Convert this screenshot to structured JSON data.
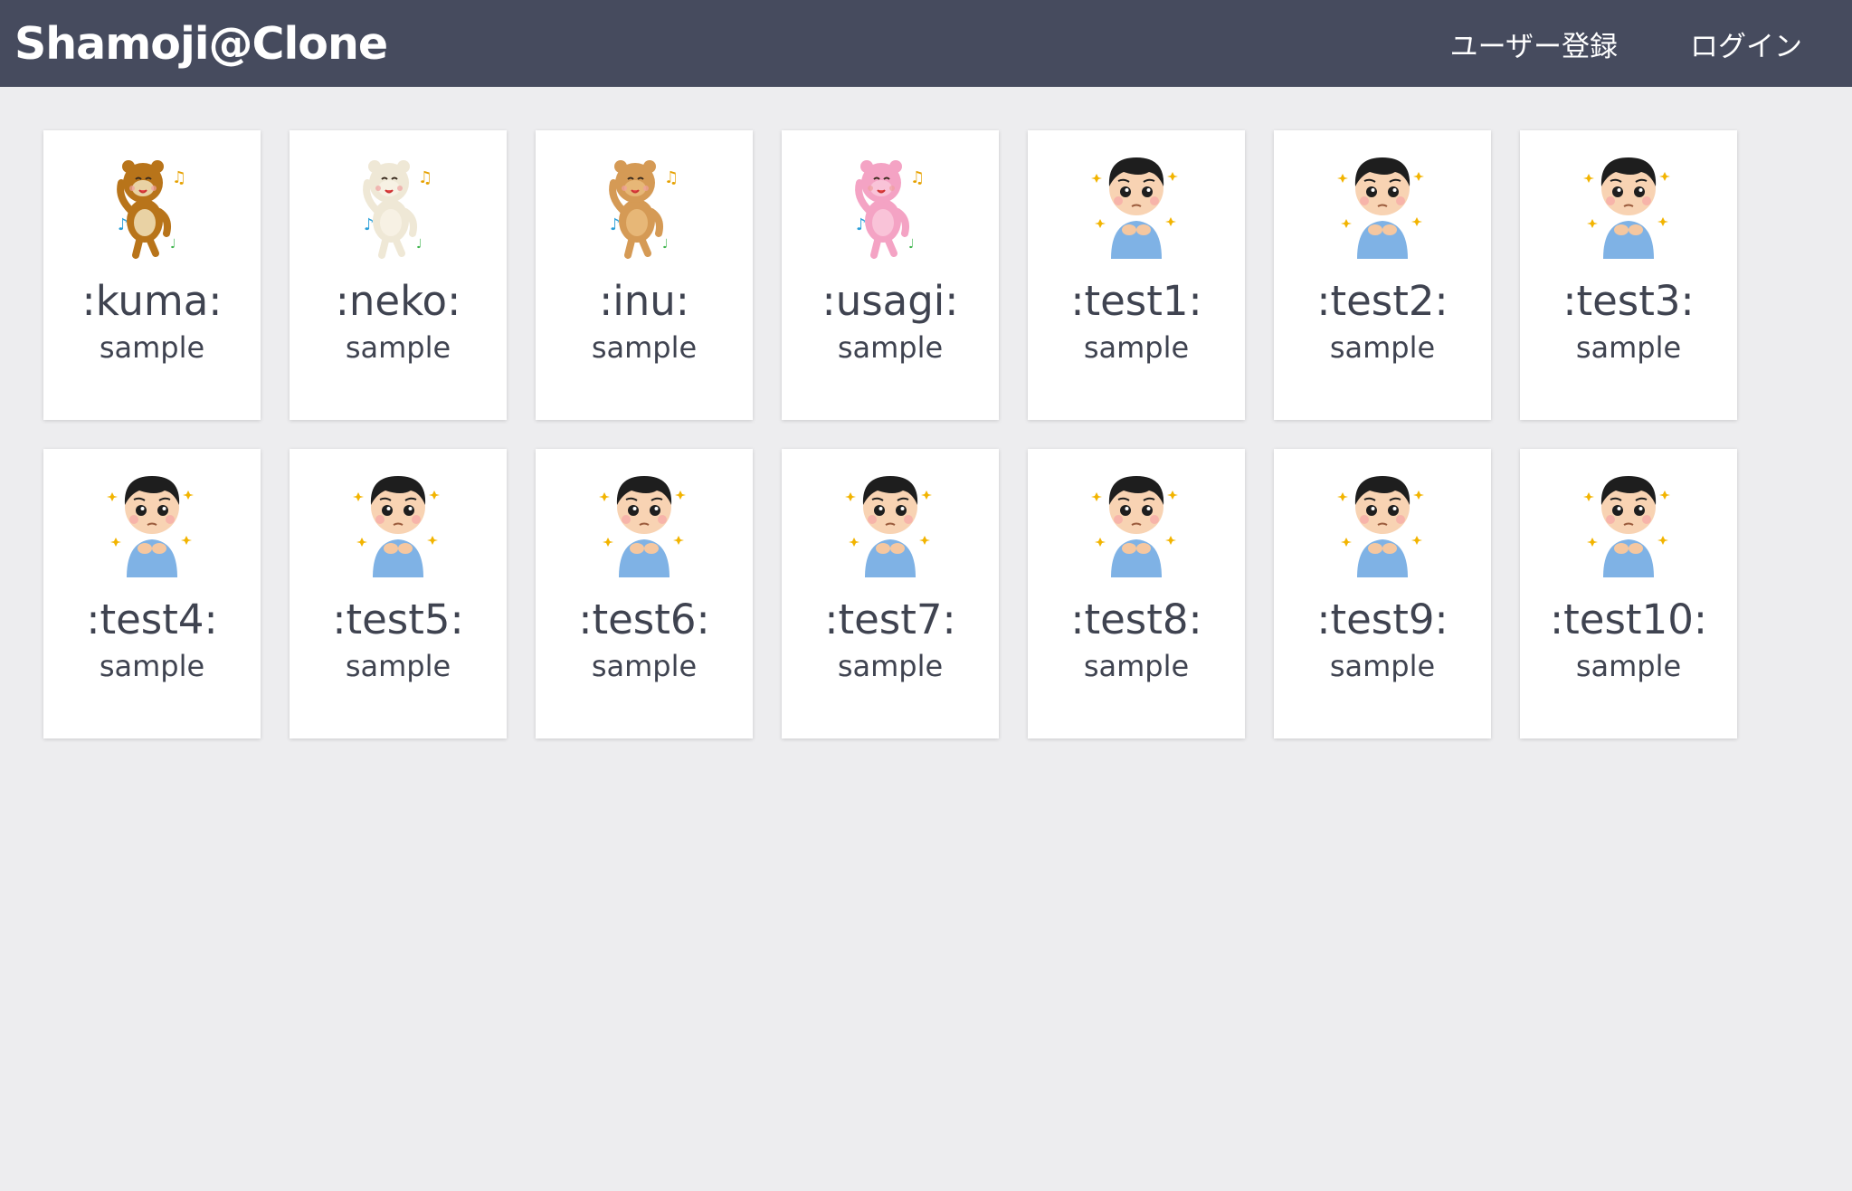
{
  "app": {
    "brand": "Shamoji@Clone",
    "nav": {
      "register_label": "ユーザー登録",
      "login_label": "ログイン"
    },
    "colors": {
      "navbar": "#464b5e",
      "background": "#ededef",
      "card": "#ffffff",
      "text": "#3f4350"
    }
  },
  "stamps": [
    {
      "name": ":kuma:",
      "description": "sample",
      "icon": "bear-dancing-icon",
      "kind": "animal",
      "body": "#b8741a",
      "face": "#e9d2a4"
    },
    {
      "name": ":neko:",
      "description": "sample",
      "icon": "cat-dancing-icon",
      "kind": "animal",
      "body": "#efe8d6",
      "face": "#f7f1e4"
    },
    {
      "name": ":inu:",
      "description": "sample",
      "icon": "dog-dancing-icon",
      "kind": "animal",
      "body": "#d59a55",
      "face": "#e7b777"
    },
    {
      "name": ":usagi:",
      "description": "sample",
      "icon": "rabbit-dancing-icon",
      "kind": "animal",
      "body": "#f4a3c4",
      "face": "#f9c3d8"
    },
    {
      "name": ":test1:",
      "description": "sample",
      "icon": "boy-pleading-icon",
      "kind": "boy"
    },
    {
      "name": ":test2:",
      "description": "sample",
      "icon": "boy-pleading-icon",
      "kind": "boy"
    },
    {
      "name": ":test3:",
      "description": "sample",
      "icon": "boy-pleading-icon",
      "kind": "boy"
    },
    {
      "name": ":test4:",
      "description": "sample",
      "icon": "boy-pleading-icon",
      "kind": "boy"
    },
    {
      "name": ":test5:",
      "description": "sample",
      "icon": "boy-pleading-icon",
      "kind": "boy"
    },
    {
      "name": ":test6:",
      "description": "sample",
      "icon": "boy-pleading-icon",
      "kind": "boy"
    },
    {
      "name": ":test7:",
      "description": "sample",
      "icon": "boy-pleading-icon",
      "kind": "boy"
    },
    {
      "name": ":test8:",
      "description": "sample",
      "icon": "boy-pleading-icon",
      "kind": "boy"
    },
    {
      "name": ":test9:",
      "description": "sample",
      "icon": "boy-pleading-icon",
      "kind": "boy"
    },
    {
      "name": ":test10:",
      "description": "sample",
      "icon": "boy-pleading-icon",
      "kind": "boy"
    }
  ]
}
